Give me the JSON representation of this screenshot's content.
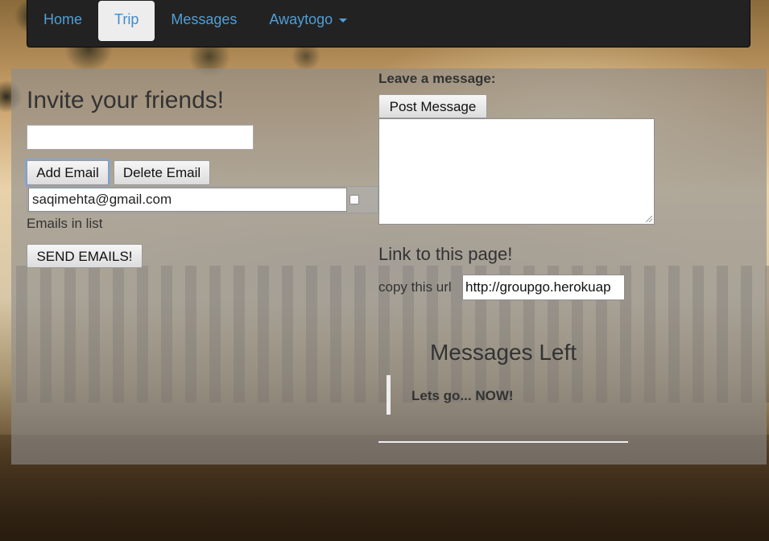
{
  "nav": {
    "items": [
      {
        "label": "Home",
        "active": false
      },
      {
        "label": "Trip",
        "active": true
      },
      {
        "label": "Messages",
        "active": false
      },
      {
        "label": "Awaytogo",
        "active": false,
        "dropdown": true
      }
    ]
  },
  "invite": {
    "title": "Invite your friends!",
    "input_value": "",
    "add_label": "Add Email",
    "delete_label": "Delete Email",
    "emails": [
      "saqimehta@gmail.com"
    ],
    "list_label": "Emails in list",
    "send_label": "SEND EMAILS!"
  },
  "message": {
    "label": "Leave a message:",
    "post_label": "Post Message",
    "text_value": ""
  },
  "link": {
    "title": "Link to this page!",
    "copy_label": "copy this url",
    "url": "http://groupgo.herokuap"
  },
  "messages_left": {
    "title": "Messages Left",
    "items": [
      "Lets go... NOW!"
    ]
  },
  "colors": {
    "navbar_bg": "#222222",
    "nav_link": "#4f9fd6",
    "active_tab_bg": "#ededed",
    "panel_overlay": "rgba(140,140,140,0.62)",
    "text": "#333333"
  },
  "icons": {
    "dropdown": "caret-down-icon",
    "email_select": "checkbox"
  }
}
